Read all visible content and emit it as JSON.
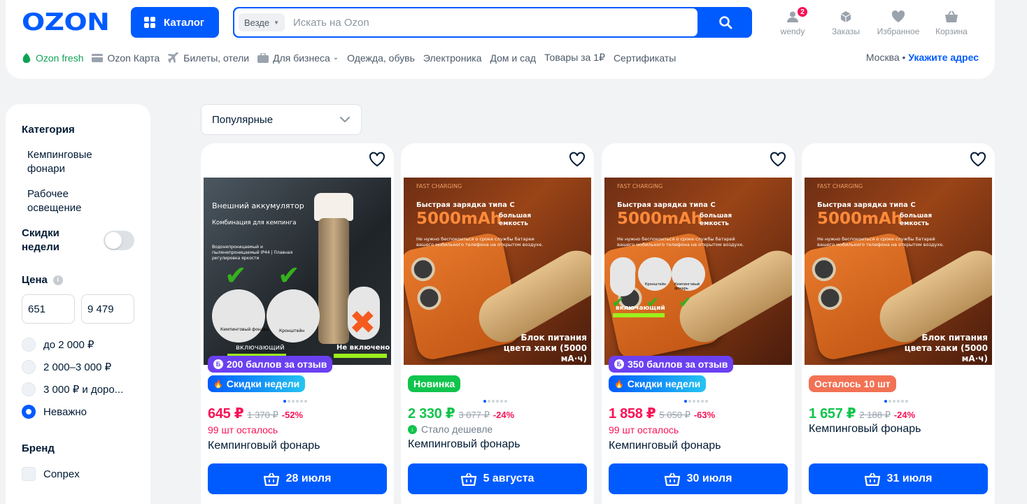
{
  "header": {
    "logo": "OZON",
    "catalog_label": "Каталог",
    "search": {
      "scope": "Везде",
      "placeholder": "Искать на Ozon"
    },
    "icons": [
      {
        "label": "wendy",
        "icon": "user-icon",
        "badge": "2"
      },
      {
        "label": "Заказы",
        "icon": "orders-icon"
      },
      {
        "label": "Избранное",
        "icon": "heart-icon"
      },
      {
        "label": "Корзина",
        "icon": "cart-icon"
      }
    ],
    "nav": [
      "Ozon fresh",
      "Ozon Карта",
      "Билеты, отели",
      "Для бизнеса",
      "Одежда, обувь",
      "Электроника",
      "Дом и сад",
      "Товары за 1₽",
      "Сертификаты"
    ],
    "city": "Москва",
    "city_sep": "•",
    "address_link": "Укажите адрес"
  },
  "sidebar": {
    "category_title": "Категория",
    "categories": [
      "Кемпинговые фонари",
      "Рабочее освещение"
    ],
    "weekly_discounts_label": "Скидки недели",
    "price_title": "Цена",
    "price_min": "651",
    "price_max": "9 479",
    "price_options": [
      "до 2 000 ₽",
      "2 000–3 000 ₽",
      "3 000 ₽ и доро...",
      "Неважно"
    ],
    "price_selected": "Неважно",
    "brand_title": "Бренд",
    "brands": [
      "Conpex"
    ]
  },
  "sort": {
    "value": "Популярные"
  },
  "products": [
    {
      "points": "200 баллов за отзыв",
      "tag": "Скидки недели",
      "price": "645 ₽",
      "old_price": "1 370 ₽",
      "discount": "-52%",
      "stock": "99 шт осталось",
      "title": "Кемпинговый фонарь",
      "delivery": "28 июля",
      "image_text": {
        "t1": "Внешний аккумулятор",
        "t2": "Комбинация для кемпинга",
        "t3": "Водонепроницаемый и пыленепроницаемый IP44 | Плавная регулировка яркости",
        "c1": "Кемпинговый фонарь",
        "c2": "Кронштейн",
        "inc": "включающий",
        "notinc": "Не включено"
      }
    },
    {
      "tag": "Новинка",
      "price": "2 330 ₽",
      "old_price": "3 077 ₽",
      "discount": "-24%",
      "note": "Стало дешевле",
      "title": "Кемпинговый фонарь",
      "delivery": "5 августа",
      "image_text": {
        "fast": "FAST CHARGING",
        "h1": "Быстрая зарядка типа C",
        "cap": "5000mAh",
        "big": "большая емкость",
        "desc": "Не нужно беспокоиться о сроке службы батареи вашего мобильного телефона на открытом воздухе.",
        "foot": "Блок питания цвета хаки (5000 мА·ч)"
      }
    },
    {
      "points": "350 баллов за отзыв",
      "tag": "Скидки недели",
      "price": "1 858 ₽",
      "old_price": "5 050 ₽",
      "discount": "-63%",
      "stock": "99 шт осталось",
      "title": "Кемпинговый фонарь",
      "delivery": "30 июля",
      "image_text": {
        "fast": "FAST CHARGING",
        "h1": "Быстрая зарядка типа C",
        "cap": "5000mAh",
        "big": "большая емкость",
        "desc": "Не нужно беспокоиться о сроке службы батарей вашего мобильного телефона на открытом воздухе.",
        "c2": "Кронштейн",
        "c3": "Кемпинговый фонарь",
        "inc": "включающий"
      }
    },
    {
      "tag": "Осталось 10 шт",
      "price": "1 657 ₽",
      "old_price": "2 188 ₽",
      "discount": "-24%",
      "title": "Кемпинговый фонарь",
      "delivery": "31 июля",
      "image_text": {
        "fast": "FAST CHARGING",
        "h1": "Быстрая зарядка типа C",
        "cap": "5000mAh",
        "big": "большая емкость",
        "desc": "Не нужно беспокоиться о сроке службы батарей вашего мобильного телефона на открытом воздухе.",
        "foot": "Блок питания цвета хаки (5000 мА·ч)"
      }
    }
  ],
  "colors": {
    "brand": "#005bff",
    "price_pink": "#f91155",
    "price_green": "#10c44c",
    "points_purple": "#6b40f1"
  }
}
